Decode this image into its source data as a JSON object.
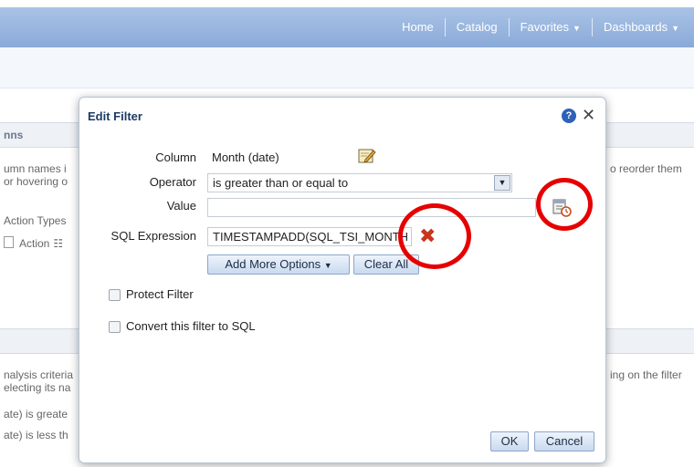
{
  "nav": {
    "items": [
      "Home",
      "Catalog",
      "Favorites",
      "Dashboards"
    ]
  },
  "background": {
    "section1_header": "nns",
    "line1": "umn names i",
    "line2": "or hovering o",
    "right_line1": "o reorder them",
    "action_types": "Action Types",
    "action": "Action",
    "section2_line1": "nalysis criteria",
    "section2_line2": "electing its na",
    "right_line2": "ing on the filter",
    "filter1": "ate)  is greate",
    "filter2": "ate)  is less th"
  },
  "dialog": {
    "title": "Edit Filter",
    "help_glyph": "?",
    "close_glyph": "✕",
    "column_label": "Column",
    "column_value": "Month (date)",
    "operator_label": "Operator",
    "operator_value": "is greater than or equal to",
    "value_label": "Value",
    "value_value": "",
    "sql_label": "SQL Expression",
    "sql_value": "TIMESTAMPADD(SQL_TSI_MONTH",
    "add_more_options": "Add More Options",
    "clear_all": "Clear All",
    "protect_filter": "Protect Filter",
    "convert_to_sql": "Convert this filter to SQL",
    "ok": "OK",
    "cancel": "Cancel"
  },
  "icons": {
    "edit": "pencil-edit-icon",
    "calendar": "calendar-icon",
    "remove": "red-x-icon"
  },
  "colors": {
    "topbar": "#8aaad8",
    "annotation": "#e60000",
    "remove": "#c8361b"
  }
}
